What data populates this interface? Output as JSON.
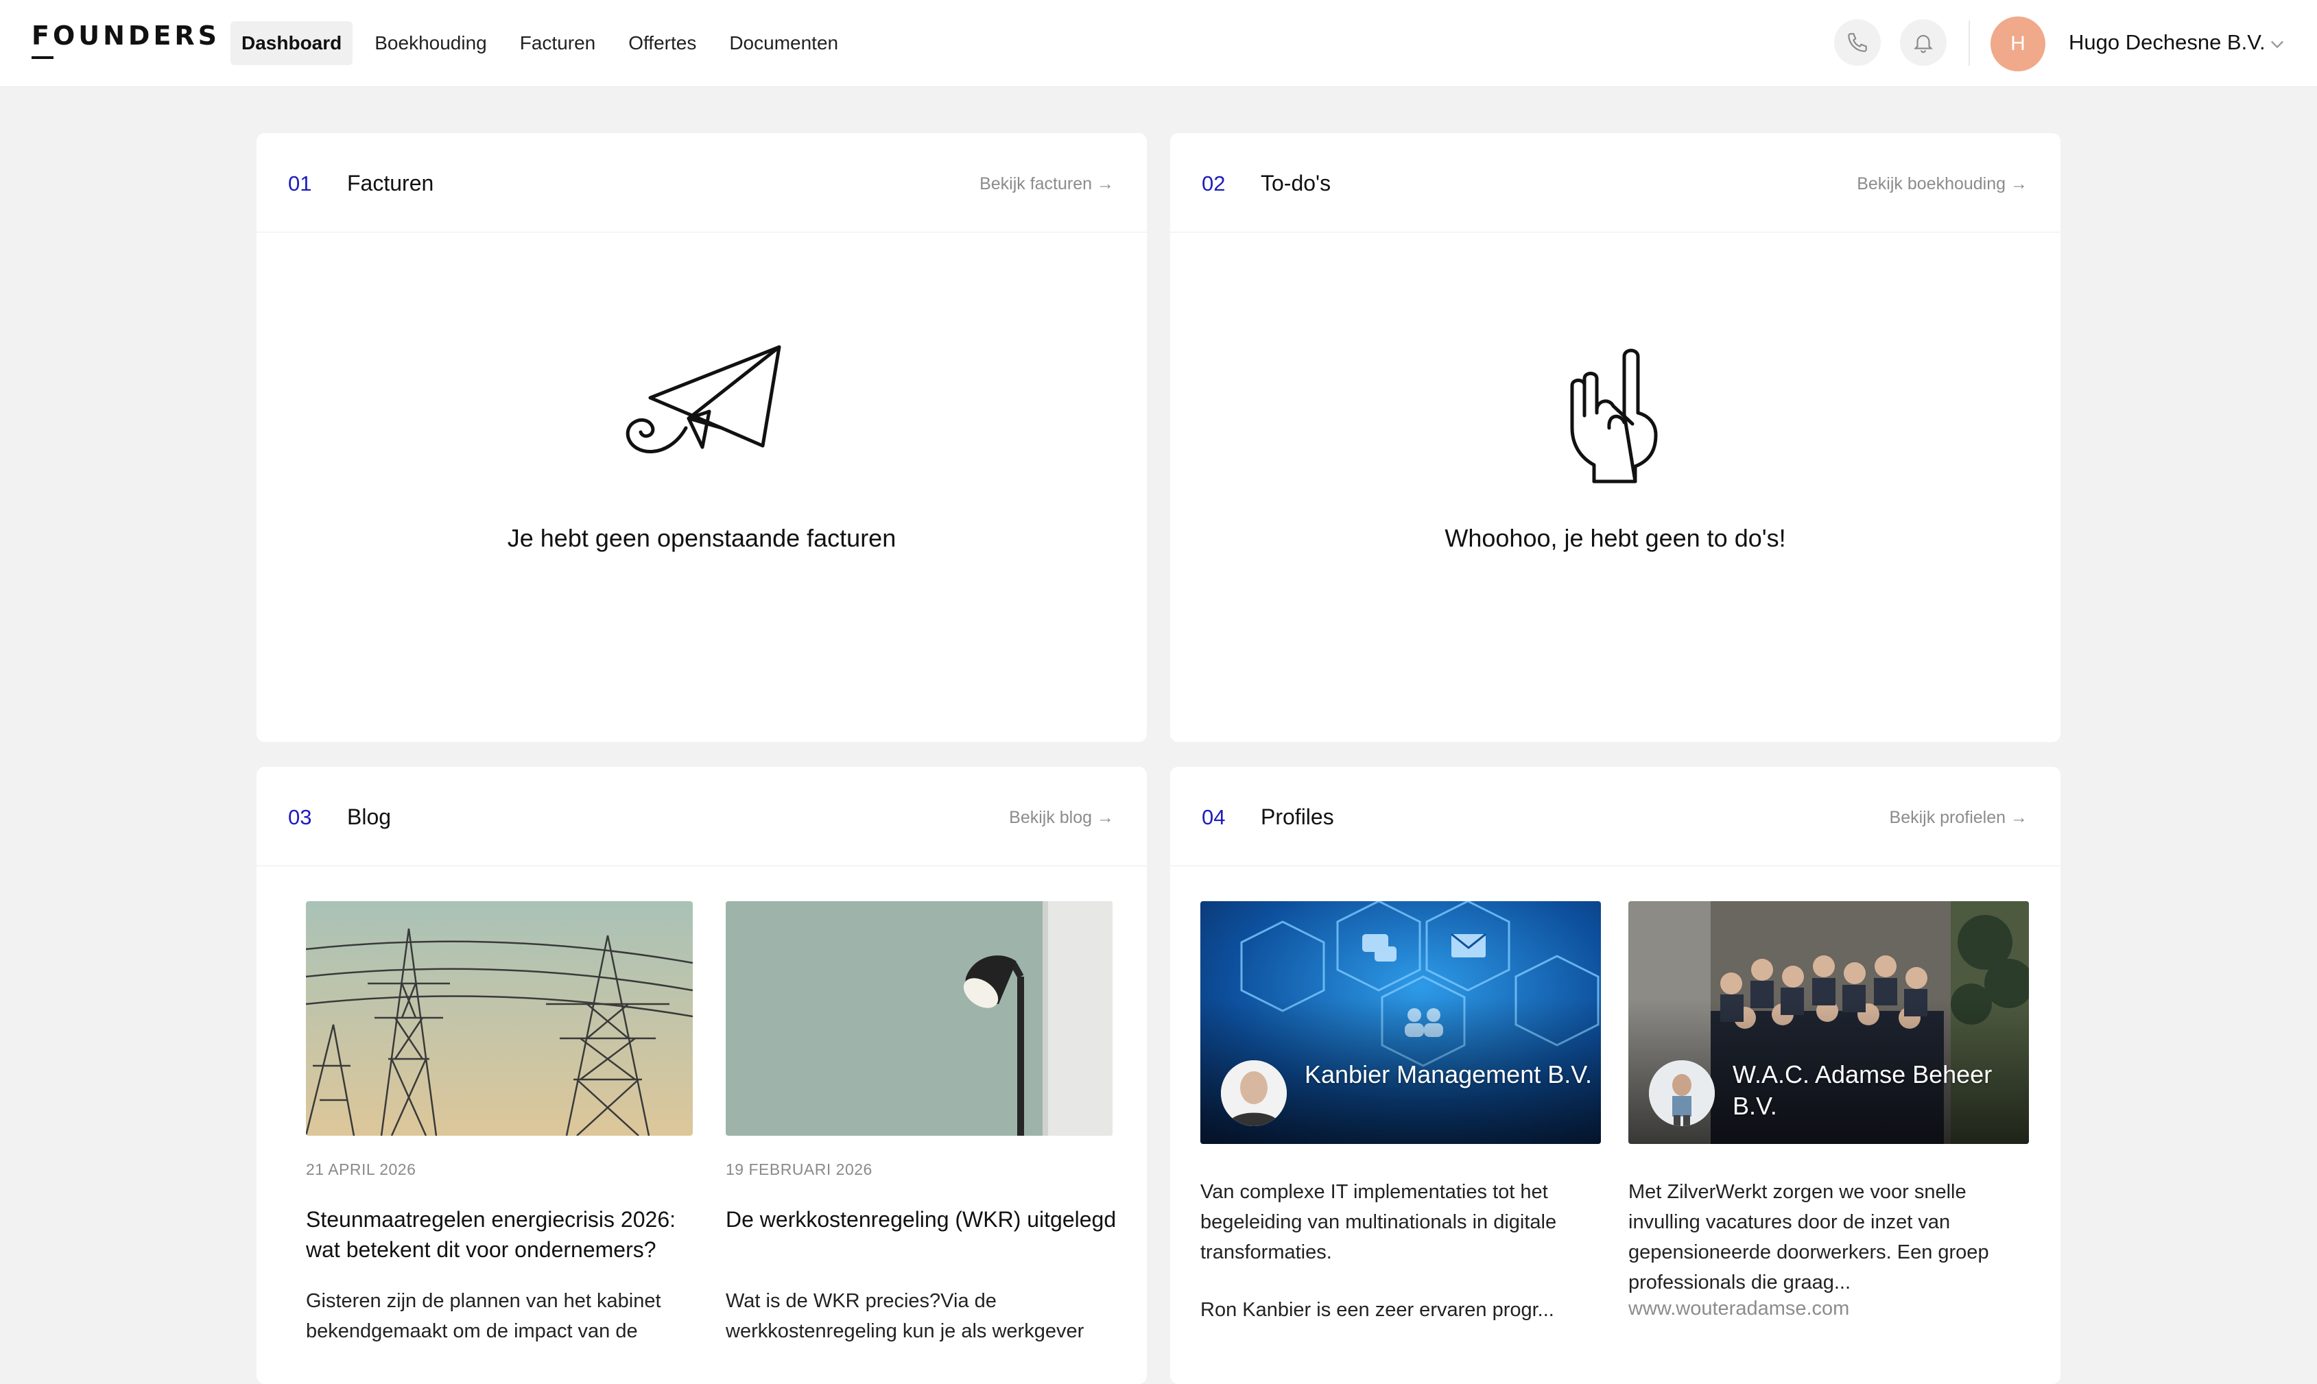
{
  "brand": {
    "logo": "FOUNDERS"
  },
  "nav": {
    "items": [
      {
        "label": "Dashboard",
        "active": true
      },
      {
        "label": "Boekhouding"
      },
      {
        "label": "Facturen"
      },
      {
        "label": "Offertes"
      },
      {
        "label": "Documenten"
      }
    ]
  },
  "header": {
    "phone_icon": "phone-icon",
    "bell_icon": "bell-icon",
    "avatar_initial": "H",
    "avatar_color": "#f0a98a",
    "company": "Hugo Dechesne B.V."
  },
  "cards": {
    "facturen": {
      "num": "01",
      "title": "Facturen",
      "link": "Bekijk facturen →",
      "icon": "paper-plane-icon",
      "empty": "Je hebt geen openstaande facturen"
    },
    "todos": {
      "num": "02",
      "title": "To-do's",
      "link": "Bekijk boekhouding →",
      "icon": "rock-hand-icon",
      "empty": "Whoohoo, je hebt geen to do's!"
    },
    "blog": {
      "num": "03",
      "title": "Blog",
      "link": "Bekijk blog →",
      "posts": [
        {
          "date": "21 APRIL 2026",
          "title": "Steunmaatregelen energiecrisis 2026: wat betekent dit voor ondernemers?",
          "excerpt": "Gisteren zijn de plannen van het kabinet bekendgemaakt om de impact van de",
          "image": "power-lines-image"
        },
        {
          "date": "19 FEBRUARI 2026",
          "title": "De werkkostenregeling (WKR) uitgelegd",
          "excerpt": "Wat is de WKR precies?Via de werkkostenregeling kun je als werkgever",
          "image": "lamp-image"
        }
      ]
    },
    "profiles": {
      "num": "04",
      "title": "Profiles",
      "link": "Bekijk profielen →",
      "items": [
        {
          "name": "Kanbier Management B.V.",
          "description": "Van complexe IT implementaties tot het begeleiding van multinationals in digitale transformaties.",
          "extra": "Ron Kanbier is een zeer ervaren progr...",
          "image": "tech-network-image"
        },
        {
          "name": "W.A.C. Adamse Beheer B.V.",
          "description": "Met ZilverWerkt zorgen we voor snelle invulling vacatures door de inzet van gepensioneerde doorwerkers. Een groep professionals die graag...",
          "link": "www.wouteradamse.com",
          "image": "team-photo-image"
        }
      ]
    }
  },
  "colors": {
    "accent": "#1d1dbd",
    "background": "#f2f2f2"
  }
}
